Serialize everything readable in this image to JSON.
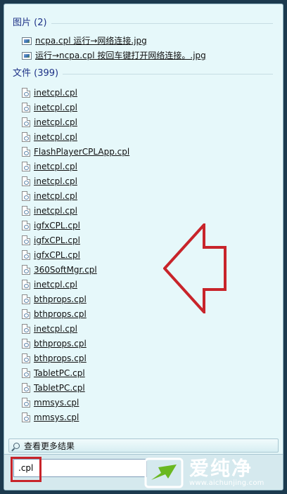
{
  "groups": {
    "pictures": {
      "title": "图片 (2)",
      "items": [
        "ncpa.cpl 运行→网络连接.jpg",
        "运行→ncpa.cpl 按回车键打开网络连接。.jpg"
      ]
    },
    "files": {
      "title": "文件 (399)",
      "items": [
        "inetcpl.cpl",
        "inetcpl.cpl",
        "inetcpl.cpl",
        "inetcpl.cpl",
        "FlashPlayerCPLApp.cpl",
        "inetcpl.cpl",
        "inetcpl.cpl",
        "inetcpl.cpl",
        "inetcpl.cpl",
        "igfxCPL.cpl",
        "igfxCPL.cpl",
        "igfxCPL.cpl",
        "360SoftMgr.cpl",
        "inetcpl.cpl",
        "bthprops.cpl",
        "bthprops.cpl",
        "inetcpl.cpl",
        "bthprops.cpl",
        "bthprops.cpl",
        "TabletPC.cpl",
        "TabletPC.cpl",
        "mmsys.cpl",
        "mmsys.cpl"
      ]
    }
  },
  "see_more": {
    "label": "查看更多结果",
    "icon": "search-icon"
  },
  "search": {
    "value": ".cpl"
  },
  "watermark": {
    "title": "爱纯净",
    "url": "www.aichunjing.com"
  },
  "colors": {
    "header": "#1e3287",
    "highlight": "#c8242a",
    "panel": "#e6f8fa"
  }
}
